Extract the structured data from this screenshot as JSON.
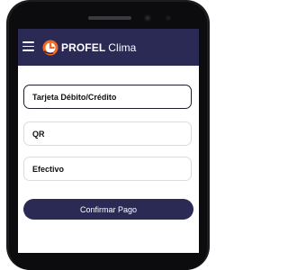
{
  "header": {
    "brand": "PROFEL",
    "brand_suffix": "Clima",
    "logo_icon": "profel-logo-icon",
    "menu_icon": "hamburger-menu-icon",
    "background_color": "#2b2a55",
    "logo_accent_color": "#f26a21"
  },
  "payment_options": [
    {
      "label": "Tarjeta Débito/Crédito",
      "selected": true
    },
    {
      "label": "QR",
      "selected": false
    },
    {
      "label": "Efectivo",
      "selected": false
    }
  ],
  "confirm_button": {
    "label": "Confirmar Pago",
    "color": "#2b2a55"
  }
}
